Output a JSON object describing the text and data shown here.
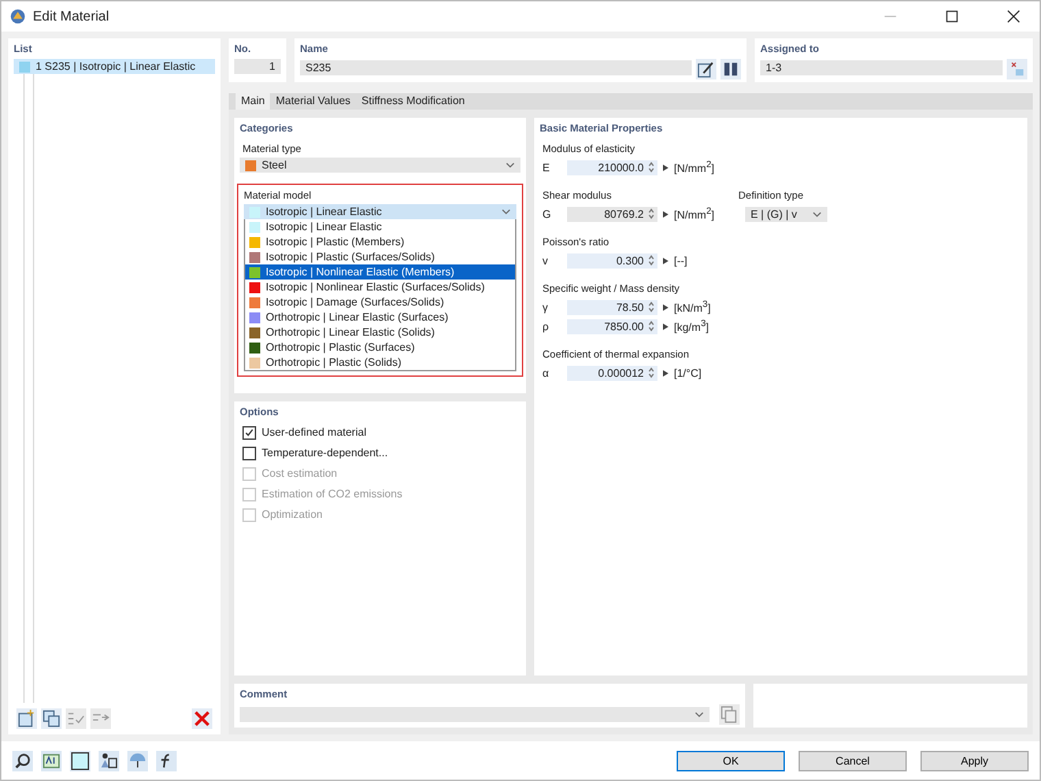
{
  "window": {
    "title": "Edit Material"
  },
  "list": {
    "title": "List",
    "items": [
      {
        "number": "1",
        "label": "S235 | Isotropic | Linear Elastic",
        "color": "#8fd3f0",
        "selected": true
      }
    ]
  },
  "header": {
    "no_label": "No.",
    "no_value": "1",
    "name_label": "Name",
    "name_value": "S235",
    "assigned_label": "Assigned to",
    "assigned_value": "1-3"
  },
  "tabs": [
    {
      "label": "Main",
      "selected": true
    },
    {
      "label": "Material Values",
      "selected": false
    },
    {
      "label": "Stiffness Modification",
      "selected": false
    }
  ],
  "categories": {
    "title": "Categories",
    "material_type_label": "Material type",
    "material_type": {
      "label": "Steel",
      "color": "#e87b2e"
    },
    "material_model_label": "Material model",
    "material_model": {
      "label": "Isotropic | Linear Elastic",
      "color": "#c8f4fa"
    },
    "options": [
      {
        "label": "Isotropic | Linear Elastic",
        "color": "#c8f4fa",
        "selected": false
      },
      {
        "label": "Isotropic | Plastic (Members)",
        "color": "#f5b800",
        "selected": false
      },
      {
        "label": "Isotropic | Plastic (Surfaces/Solids)",
        "color": "#b07878",
        "selected": false
      },
      {
        "label": "Isotropic | Nonlinear Elastic (Members)",
        "color": "#7cc22c",
        "selected": true
      },
      {
        "label": "Isotropic | Nonlinear Elastic (Surfaces/Solids)",
        "color": "#ee1010",
        "selected": false
      },
      {
        "label": "Isotropic | Damage (Surfaces/Solids)",
        "color": "#ee7a3c",
        "selected": false
      },
      {
        "label": "Orthotropic | Linear Elastic (Surfaces)",
        "color": "#8c8cf5",
        "selected": false
      },
      {
        "label": "Orthotropic | Linear Elastic (Solids)",
        "color": "#8a6428",
        "selected": false
      },
      {
        "label": "Orthotropic | Plastic (Surfaces)",
        "color": "#2f5e12",
        "selected": false
      },
      {
        "label": "Orthotropic | Plastic (Solids)",
        "color": "#ecc8a0",
        "selected": false
      }
    ]
  },
  "options": {
    "title": "Options",
    "items": [
      {
        "label": "User-defined material",
        "checked": true,
        "disabled": false
      },
      {
        "label": "Temperature-dependent...",
        "checked": false,
        "disabled": false
      },
      {
        "label": "Cost estimation",
        "checked": false,
        "disabled": true
      },
      {
        "label": "Estimation of CO2 emissions",
        "checked": false,
        "disabled": true
      },
      {
        "label": "Optimization",
        "checked": false,
        "disabled": true
      }
    ]
  },
  "properties": {
    "title": "Basic Material Properties",
    "groups": [
      {
        "label": "Modulus of elasticity",
        "rows": [
          {
            "symbol": "E",
            "value": "210000.0",
            "unit": "[N/mm$^{2}$]",
            "disabled": false
          }
        ]
      },
      {
        "label": "Shear modulus",
        "rows": [
          {
            "symbol": "G",
            "value": "80769.2",
            "unit": "[N/mm$^{2}$]",
            "disabled": true
          }
        ],
        "side": {
          "label": "Definition type",
          "value": "E | (G) | v"
        }
      },
      {
        "label": "Poisson's ratio",
        "rows": [
          {
            "symbol": "v",
            "value": "0.300",
            "unit": "[--]",
            "disabled": false
          }
        ]
      },
      {
        "label": "Specific weight / Mass density",
        "rows": [
          {
            "symbol": "γ",
            "value": "78.50",
            "unit": "[kN/m$^{3}$]",
            "disabled": false
          },
          {
            "symbol": "ρ",
            "value": "7850.00",
            "unit": "[kg/m$^{3}$]",
            "disabled": false
          }
        ]
      },
      {
        "label": "Coefficient of thermal expansion",
        "rows": [
          {
            "symbol": "α",
            "value": "0.000012",
            "unit": "[1/°C]",
            "disabled": false
          }
        ]
      }
    ]
  },
  "comment": {
    "title": "Comment"
  },
  "buttons": [
    {
      "label": "OK",
      "kind": "default"
    },
    {
      "label": "Cancel",
      "kind": "normal"
    },
    {
      "label": "Apply",
      "kind": "normal"
    }
  ]
}
